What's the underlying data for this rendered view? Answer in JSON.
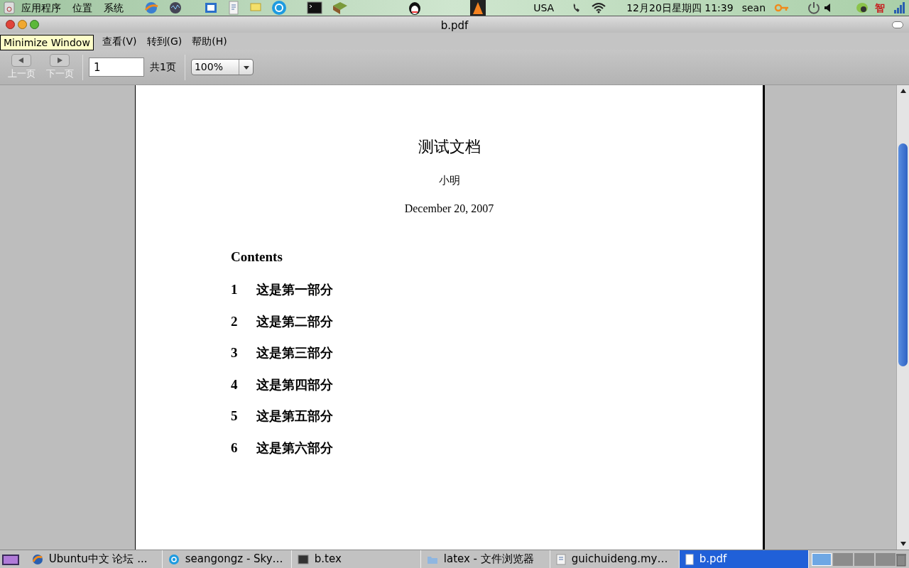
{
  "top_panel": {
    "menus": [
      "应用程序",
      "位置",
      "系统"
    ],
    "tray_texts": {
      "keyboard": "USA",
      "clock": "12月20日星期四 11:39",
      "user": "sean",
      "ime": "智"
    }
  },
  "window": {
    "title": "b.pdf",
    "tooltip": "Minimize Window"
  },
  "menubar": [
    "查看(V)",
    "转到(G)",
    "帮助(H)"
  ],
  "toolbar": {
    "prev_label": "上一页",
    "next_label": "下一页",
    "page_value": "1",
    "page_count": "共1页",
    "zoom": "100%"
  },
  "document": {
    "title": "测试文档",
    "author": "小明",
    "date": "December 20, 2007",
    "contents_heading": "Contents",
    "toc": [
      {
        "number": "1",
        "title": "这是第一部分"
      },
      {
        "number": "2",
        "title": "这是第二部分"
      },
      {
        "number": "3",
        "title": "这是第三部分"
      },
      {
        "number": "4",
        "title": "这是第四部分"
      },
      {
        "number": "5",
        "title": "这是第五部分"
      },
      {
        "number": "6",
        "title": "这是第六部分"
      }
    ]
  },
  "taskbar": {
    "tasks": [
      {
        "kind": "browser",
        "label": "Ubuntu中文 论坛 ...",
        "selected": false
      },
      {
        "kind": "chat",
        "label": "seangongz - Sky…",
        "selected": false
      },
      {
        "kind": "terminal",
        "label": "b.tex",
        "selected": false
      },
      {
        "kind": "folder",
        "label": "latex - 文件浏览器",
        "selected": false
      },
      {
        "kind": "document",
        "label": "guichuideng.my…",
        "selected": false
      },
      {
        "kind": "pdf",
        "label": "b.pdf",
        "selected": true
      }
    ],
    "workspaces": [
      {
        "selected": true
      },
      {
        "selected": false
      },
      {
        "selected": false
      },
      {
        "selected": false
      }
    ]
  }
}
